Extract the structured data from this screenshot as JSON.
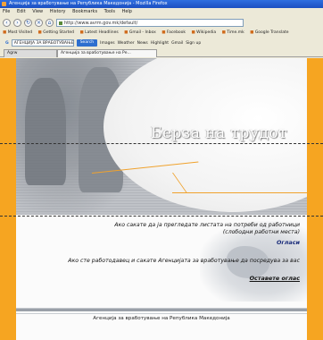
{
  "window": {
    "title": "Агенција за вработување на Република Македонија - Mozilla Firefox"
  },
  "menu": [
    "File",
    "Edit",
    "View",
    "History",
    "Bookmarks",
    "Tools",
    "Help"
  ],
  "nav": {
    "url": "http://www.avrm.gov.mk/default/"
  },
  "bookmarks": [
    "Most Visited",
    "Getting Started",
    "Latest Headlines",
    "Gmail - Inbox",
    "Facebook",
    "Wikipedia",
    "Time.mk",
    "Google Translate"
  ],
  "search": {
    "placeholder": "",
    "value": "АГЕНЦИЈА ЗА ВРАБОТУВАЊЕ",
    "button_label": "Search",
    "extras": [
      "Images",
      "Weather",
      "News",
      "Highlight",
      "Gmail",
      "Sign up"
    ]
  },
  "tabs": [
    {
      "label": "Agrw"
    },
    {
      "label": "Агенција за вработување на Ре..."
    }
  ],
  "page": {
    "brand_title": "Берза на трудот",
    "jobseeker_text": "Ако сакате да ја прегледате листата на потреби од работници (слободни работни места)",
    "jobseeker_link": "Огласи",
    "employer_text": "Ако сте работодавец и сакате Агенцијата за вработување да посредува за вас",
    "employer_link": "Оставете оглас",
    "footer": "Агенција за вработување на Република Македонија"
  },
  "colors": {
    "side_bg": "#f6a521",
    "link": "#1a2c7a",
    "accent_line": "#f0a22d"
  }
}
